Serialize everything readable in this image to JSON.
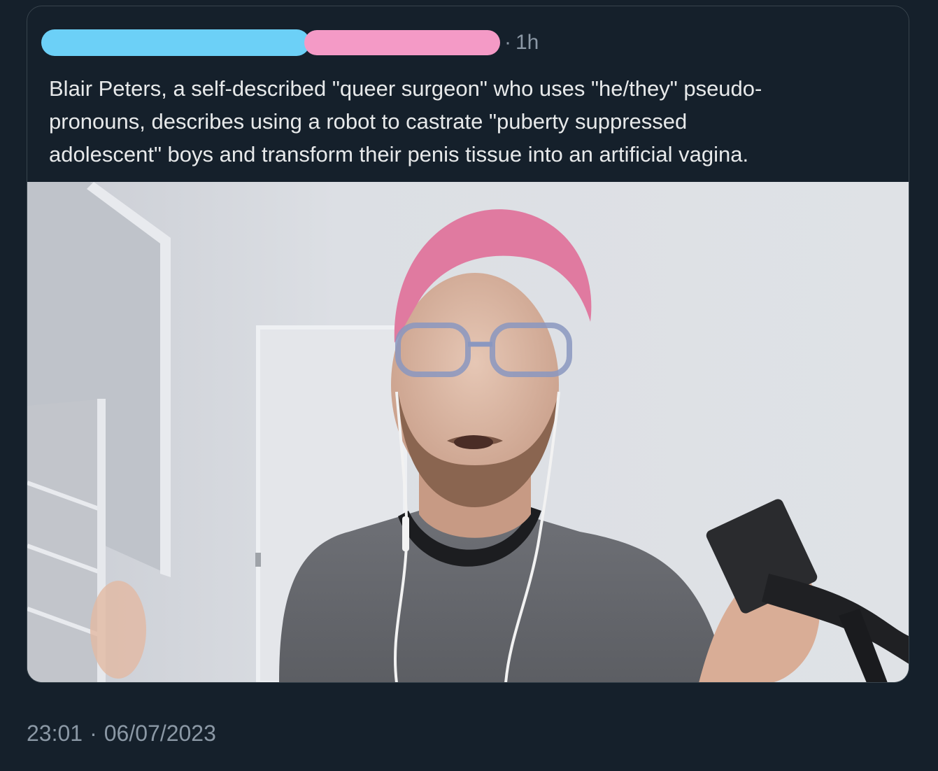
{
  "quoted_tweet": {
    "separator": "·",
    "time_ago": "1h",
    "text": "Blair Peters, a self-described \"queer surgeon\" who uses \"he/they\" pseudo-\npronouns, describes using a robot to castrate \"puberty suppressed\nadolescent\" boys and transform their penis tissue into an artificial vagina."
  },
  "colors": {
    "background": "#15202b",
    "border": "#38444d",
    "text_primary": "#e7e9ea",
    "text_secondary": "#8b98a5",
    "redaction_blue": "#6cd0f7",
    "redaction_pink": "#f49ac6"
  },
  "footer": {
    "time": "23:01",
    "separator": "·",
    "date": "06/07/2023"
  }
}
